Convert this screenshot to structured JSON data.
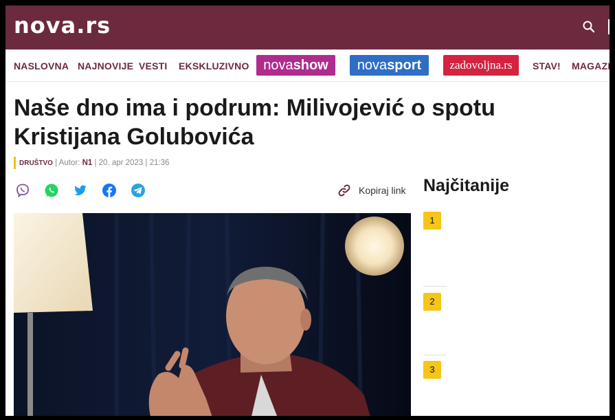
{
  "brand": {
    "logo": "nova.rs"
  },
  "nav": {
    "items": [
      "NASLOVNA",
      "NAJNOVIJE",
      "VESTI",
      "EKSKLUZIVNO"
    ],
    "novashow": {
      "a": "nova",
      "b": "show",
      "color": "#b12b8f"
    },
    "novasport": {
      "a": "nova",
      "b": "sport",
      "color": "#2f6ec5"
    },
    "zadovoljna": {
      "label": "zadovoljna.rs",
      "color": "#d42340"
    },
    "tail": [
      "STAV!",
      "MAGAZIN"
    ]
  },
  "article": {
    "title": "Naše dno ima i podrum: Milivojević o spotu Kristijana Golubovića",
    "category": "DRUŠTVO",
    "author_label": "Autor:",
    "author": "N1",
    "date": "20. apr 2023 | 21:36",
    "copy_link": "Kopiraj link"
  },
  "share_icons": [
    "viber-icon",
    "whatsapp-icon",
    "twitter-icon",
    "facebook-icon",
    "telegram-icon"
  ],
  "sidebar": {
    "title": "Najčitanije",
    "ranks": [
      "1",
      "2",
      "3"
    ]
  },
  "colors": {
    "brand": "#6b2a3e",
    "accent": "#f5c518"
  }
}
